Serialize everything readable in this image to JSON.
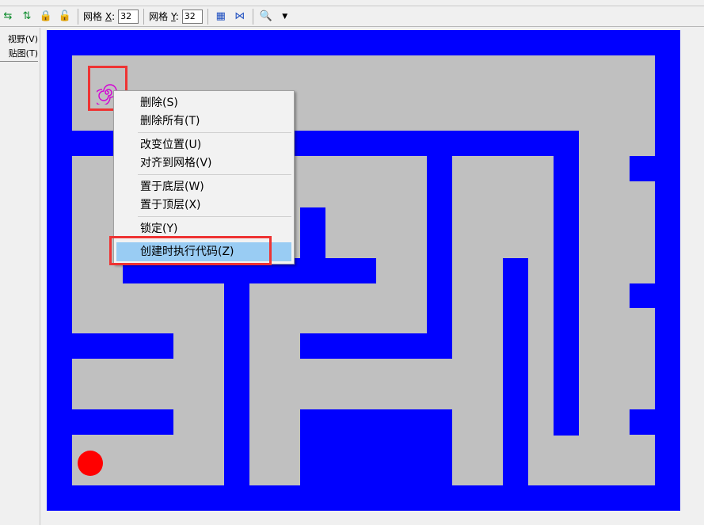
{
  "toolbar": {
    "grid_x_label": "网格",
    "grid_x_axis": "X",
    "grid_x_value": "32",
    "grid_y_label": "网格",
    "grid_y_axis": "Y",
    "grid_y_value": "32"
  },
  "left_panel": {
    "tab_view": "视野(V)",
    "tab_tile": "贴图(T)"
  },
  "context_menu": {
    "items": [
      {
        "label": "删除(S)"
      },
      {
        "label": "删除所有(T)"
      },
      {
        "label": "改变位置(U)"
      },
      {
        "label": "对齐到网格(V)"
      },
      {
        "label": "置于底层(W)"
      },
      {
        "label": "置于顶层(X)"
      },
      {
        "label": "锁定(Y)"
      },
      {
        "label": "创建时执行代码(Z)"
      }
    ],
    "highlighted_item": "创建时执行代码(Z)"
  },
  "room": {
    "wall_color": "#0000ff",
    "floor_color": "#c0c0c0",
    "player_color": "#ff0000",
    "object_icon": "spiral-icon",
    "annotation_color": "#ee3333"
  }
}
